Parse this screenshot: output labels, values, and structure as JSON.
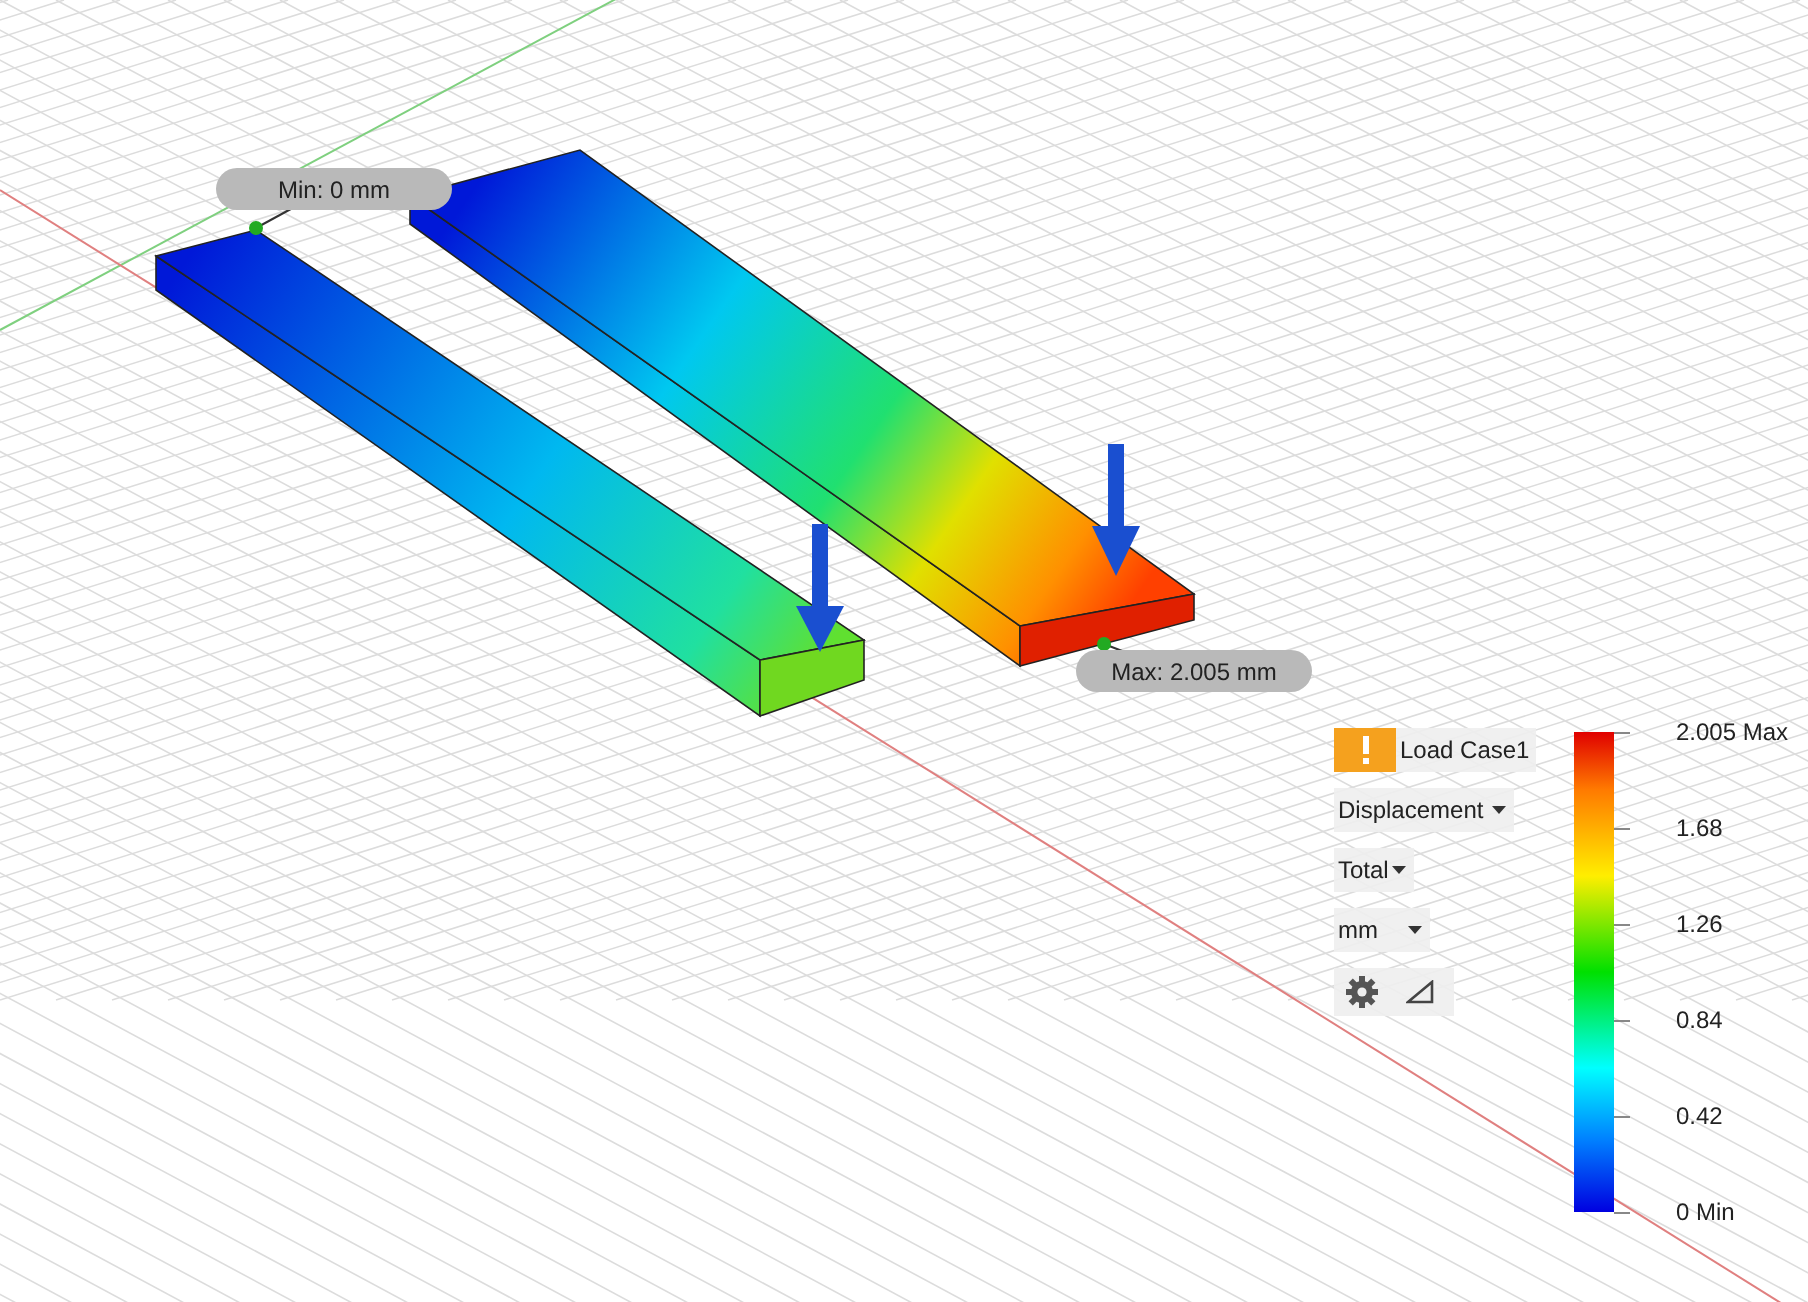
{
  "viewport": {
    "min_label": "Min: 0 mm",
    "max_label": "Max: 2.005 mm"
  },
  "legend": {
    "load_case": "Load Case1",
    "result_type": "Displacement",
    "component": "Total",
    "unit": "mm",
    "scale_labels": [
      "2.005 Max",
      "1.68",
      "1.26",
      "0.84",
      "0.42",
      "0 Min"
    ]
  }
}
